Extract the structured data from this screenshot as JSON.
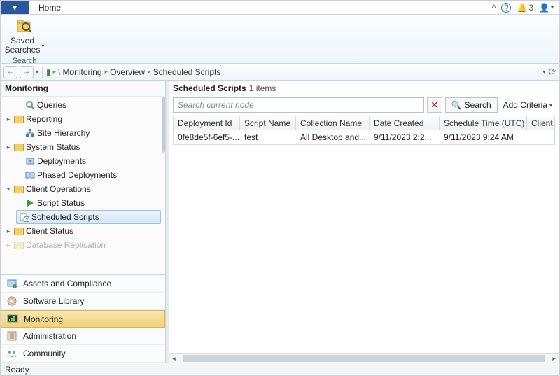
{
  "titlebar": {
    "tab_home": "Home",
    "caret_icon": "▾",
    "help_icon": "?",
    "bell_icon": "🔔",
    "notif_count": "3",
    "user_icon": "👤"
  },
  "ribbon": {
    "saved_searches_label": "Saved Searches",
    "group_label": "Search"
  },
  "breadcrumb": {
    "back": "←",
    "forward": "→",
    "items": [
      "Monitoring",
      "Overview",
      "Scheduled Scripts"
    ],
    "chevron": "▸",
    "caret": "▾",
    "refresh": "⟳"
  },
  "left": {
    "title": "Monitoring",
    "tree": [
      {
        "label": "Queries",
        "icon": "lens",
        "indent": 2,
        "exp": ""
      },
      {
        "label": "Reporting",
        "icon": "folder",
        "indent": 1,
        "exp": "▸"
      },
      {
        "label": "Site Hierarchy",
        "icon": "hier",
        "indent": 2,
        "exp": ""
      },
      {
        "label": "System Status",
        "icon": "folder",
        "indent": 1,
        "exp": "▸"
      },
      {
        "label": "Deployments",
        "icon": "deploy",
        "indent": 2,
        "exp": ""
      },
      {
        "label": "Phased Deployments",
        "icon": "phased",
        "indent": 2,
        "exp": ""
      },
      {
        "label": "Client Operations",
        "icon": "folder",
        "indent": 1,
        "exp": "▾"
      },
      {
        "label": "Script Status",
        "icon": "play",
        "indent": 2,
        "exp": ""
      },
      {
        "label": "Scheduled Scripts",
        "icon": "sched",
        "indent": 2,
        "exp": "",
        "selected": true
      },
      {
        "label": "Client Status",
        "icon": "folder",
        "indent": 1,
        "exp": "▸"
      },
      {
        "label": "Database Replication",
        "icon": "folder",
        "indent": 1,
        "exp": "▸",
        "faded": true
      }
    ],
    "wunderbar": [
      {
        "label": "Assets and Compliance",
        "icon": "assets"
      },
      {
        "label": "Software Library",
        "icon": "library"
      },
      {
        "label": "Monitoring",
        "icon": "monitor",
        "active": true
      },
      {
        "label": "Administration",
        "icon": "admin"
      },
      {
        "label": "Community",
        "icon": "community"
      }
    ]
  },
  "right": {
    "header_title": "Scheduled Scripts",
    "header_count": "1 items",
    "search_placeholder": "Search current node",
    "clear_label": "✕",
    "search_btn": "Search",
    "search_icon": "🔍",
    "criteria_label": "Add Criteria",
    "columns": [
      "Deployment Id",
      "Script Name",
      "Collection Name",
      "Date Created",
      "Schedule Time (UTC)",
      "Client Operation ID"
    ],
    "rows": [
      {
        "cells": [
          "0fe8de5f-6ef5-...",
          "test",
          "All Desktop and...",
          "9/11/2023 2:2...",
          "9/11/2023 9:24 AM",
          ""
        ]
      }
    ]
  },
  "status": {
    "text": "Ready"
  }
}
